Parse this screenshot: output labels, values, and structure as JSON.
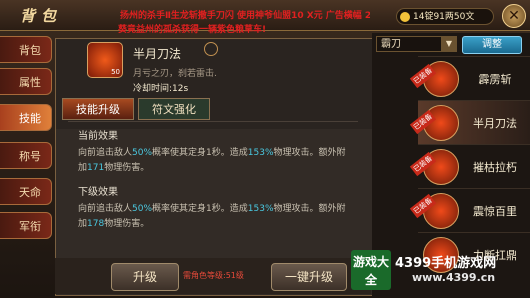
{
  "header": {
    "title": "背包",
    "ticker_line1": "扬州的杀手Ⅱ生龙斩撒手刀闪 使用神爷仙盟10 Ⅹ元 广告横幅 2 Ⅳ仙龙",
    "ticker_line2": "葵竟益州的孤杀获得一辆紫色粮草车!",
    "currency": "14锭91两50文",
    "close_label": "✕"
  },
  "sidebar": {
    "items": [
      {
        "label": "背包",
        "active": false
      },
      {
        "label": "属性",
        "active": false
      },
      {
        "label": "技能",
        "active": true
      },
      {
        "label": "称号",
        "active": false
      },
      {
        "label": "天命",
        "active": false
      },
      {
        "label": "军衔",
        "active": false
      }
    ]
  },
  "skill": {
    "name": "半月刀法",
    "level": "50",
    "desc": "月亏之刃，刹若雷击.",
    "cooldown_label": "冷却时间:",
    "cooldown_value": "12s"
  },
  "tabs": [
    {
      "label": "技能升级",
      "active": true
    },
    {
      "label": "符文强化",
      "active": false
    }
  ],
  "current": {
    "title": "当前效果",
    "text_a": "向前追击敌人",
    "pct1": "50%",
    "text_b": "概率使其定身1秒。造成",
    "pct2": "153%",
    "text_c": "物理攻击。额外附加",
    "add": "171",
    "text_d": "物理伤害。"
  },
  "next": {
    "title": "下级效果",
    "text_a": "向前追击敌人",
    "pct1": "50%",
    "text_b": "概率使其定身1秒。造成",
    "pct2": "153%",
    "text_c": "物理攻击。额外附加",
    "add": "178",
    "text_d": "物理伤害。"
  },
  "bottom": {
    "upgrade": "升级",
    "requirement": "需角色等级:51级",
    "upgrade_all": "一键升级"
  },
  "filter": {
    "selected": "霸刀",
    "tune_label": "调整"
  },
  "skill_list": [
    {
      "label": "霹雳斩",
      "equipped": true
    },
    {
      "label": "半月刀法",
      "equipped": true
    },
    {
      "label": "摧枯拉朽",
      "equipped": true
    },
    {
      "label": "震惊百里",
      "equipped": true
    },
    {
      "label": "力断扛鼎",
      "equipped": false
    }
  ],
  "equipped_badge": "已装备",
  "watermark": {
    "box": "游戏大全",
    "site": "4399手机游戏网",
    "url": "www.4399.cn"
  }
}
